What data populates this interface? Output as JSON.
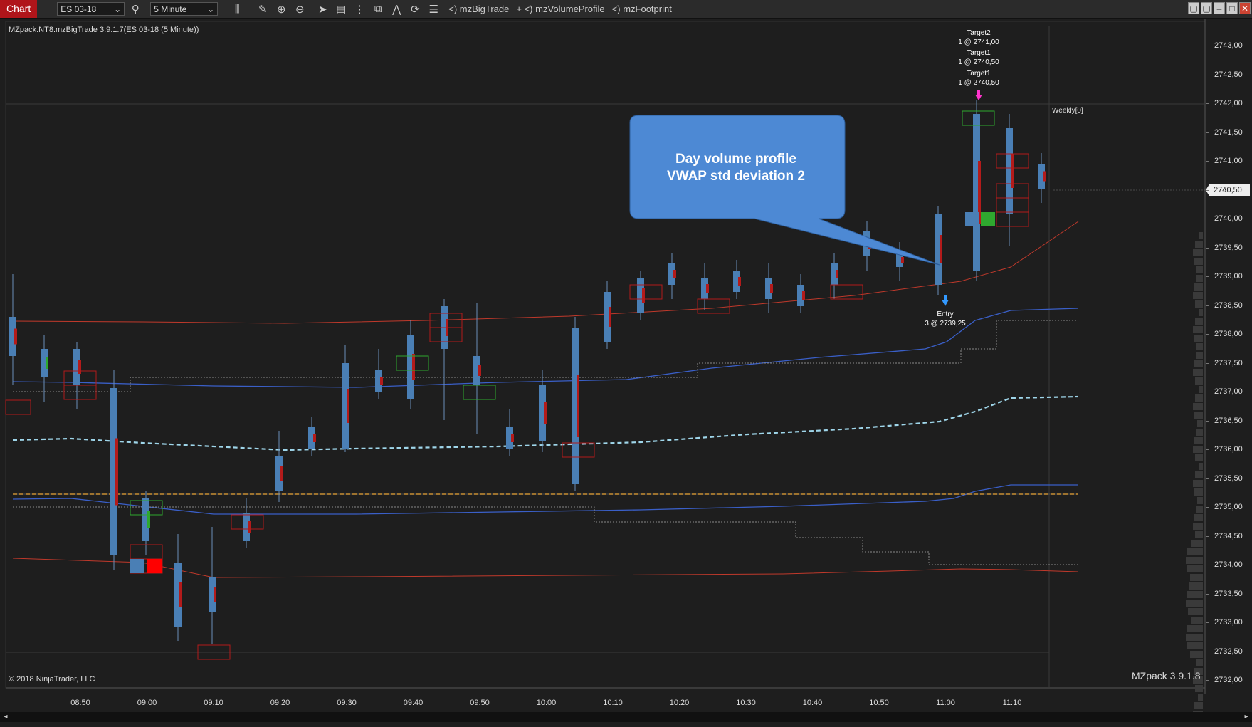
{
  "toolbar": {
    "tab": "Chart",
    "instrument": "ES 03-18",
    "interval": "5 Minute",
    "indicators": [
      "<) mzBigTrade",
      "+ <) mzVolumeProfile",
      "<) mzFootprint"
    ]
  },
  "chart": {
    "info": "MZpack.NT8.mzBigTrade 3.9.1.7(ES 03-18 (5 Minute))",
    "copyright": "© 2018 NinjaTrader, LLC",
    "version": "MZpack 3.9.1.8",
    "weekly_label": "Weekly[0]",
    "current_price": "2740,50",
    "callout": [
      "Day volume profile",
      "VWAP std deviation 2"
    ],
    "trades": {
      "entry": [
        "Entry",
        "3 @ 2739,25"
      ],
      "targets": [
        [
          "Target2",
          "1 @ 2741,00"
        ],
        [
          "Target1",
          "1 @ 2740,50"
        ],
        [
          "Target1",
          "1 @ 2740,50"
        ]
      ]
    }
  },
  "y_axis": [
    "2743,00",
    "2742,50",
    "2742,00",
    "2741,50",
    "2741,00",
    "2740,50",
    "2740,00",
    "2739,50",
    "2739,00",
    "2738,50",
    "2738,00",
    "2737,50",
    "2737,00",
    "2736,50",
    "2736,00",
    "2735,50",
    "2735,00",
    "2734,50",
    "2734,00",
    "2733,50",
    "2733,00",
    "2732,50",
    "2732,00"
  ],
  "x_axis": [
    "08:50",
    "09:00",
    "09:10",
    "09:20",
    "09:30",
    "09:40",
    "09:50",
    "10:00",
    "10:10",
    "10:20",
    "10:30",
    "10:40",
    "10:50",
    "11:00",
    "11:10"
  ],
  "colors": {
    "background": "#1e1e1e",
    "up_candle": "#2fa82f",
    "down_candle": "#b31b1b",
    "volume_bar": "#4a7fb5",
    "vwap": "#9fd6ea",
    "band_blue": "#3a5fc8",
    "band_red": "#c0392b",
    "poc": "#f39c12",
    "callout": "#4d89d4",
    "tab": "#b0151a"
  }
}
